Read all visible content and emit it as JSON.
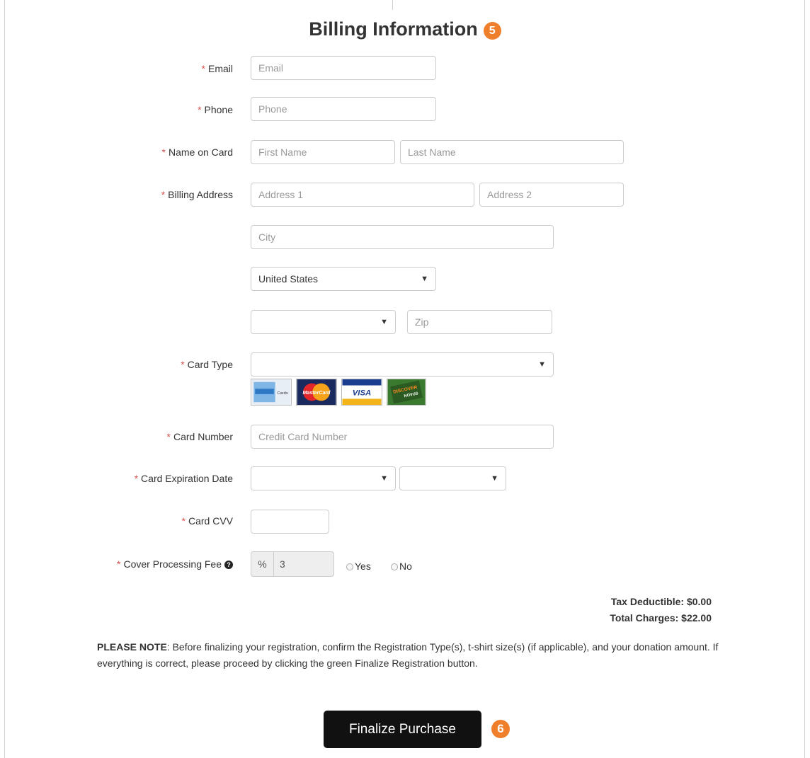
{
  "header": {
    "title": "Billing Information",
    "step": "5"
  },
  "fields": {
    "email": {
      "label": "Email",
      "placeholder": "Email"
    },
    "phone": {
      "label": "Phone",
      "placeholder": "Phone"
    },
    "name_on_card": {
      "label": "Name on Card",
      "first_placeholder": "First Name",
      "last_placeholder": "Last Name"
    },
    "billing_address": {
      "label": "Billing Address",
      "address1_placeholder": "Address 1",
      "address2_placeholder": "Address 2",
      "city_placeholder": "City",
      "country_value": "United States",
      "state_value": "",
      "zip_placeholder": "Zip"
    },
    "card_type": {
      "label": "Card Type",
      "value": "",
      "accepted_cards": [
        "American Express",
        "MasterCard",
        "VISA",
        "Discover Novus"
      ]
    },
    "card_number": {
      "label": "Card Number",
      "placeholder": "Credit Card Number"
    },
    "card_expiration": {
      "label": "Card Expiration Date",
      "month_value": "",
      "year_value": ""
    },
    "card_cvv": {
      "label": "Card CVV",
      "value": ""
    },
    "processing_fee": {
      "label": "Cover Processing Fee",
      "addon": "%",
      "value": "3",
      "option_yes": "Yes",
      "option_no": "No"
    }
  },
  "required_marker": "*",
  "totals": {
    "tax_deductible": "Tax Deductible: $0.00",
    "total_charges": "Total Charges: $22.00"
  },
  "note": {
    "strong": "PLEASE NOTE",
    "text": ": Before finalizing your registration, confirm the Registration Type(s), t-shirt size(s) (if applicable), and your donation amount. If everything is correct, please proceed by clicking the green Finalize Registration button."
  },
  "actions": {
    "finalize_label": "Finalize Purchase",
    "step": "6"
  },
  "colors": {
    "accent": "#f07f2c",
    "required": "#d9534f",
    "button_bg": "#111111"
  },
  "icons": {
    "help": "question-circle-icon",
    "caret": "caret-down-icon"
  }
}
